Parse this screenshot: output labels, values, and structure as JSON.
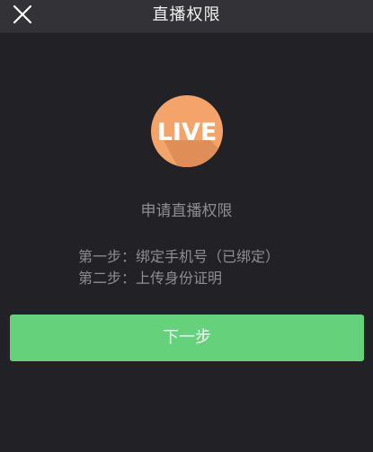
{
  "header": {
    "title": "直播权限",
    "close_icon": "close-icon"
  },
  "logo": {
    "text": "LIVE",
    "color": "#F4A46A"
  },
  "main": {
    "heading": "申请直播权限",
    "steps": [
      "第一步：绑定手机号（已绑定）",
      "第二步：上传身份证明"
    ],
    "next_label": "下一步",
    "accent_color": "#66D17B"
  }
}
